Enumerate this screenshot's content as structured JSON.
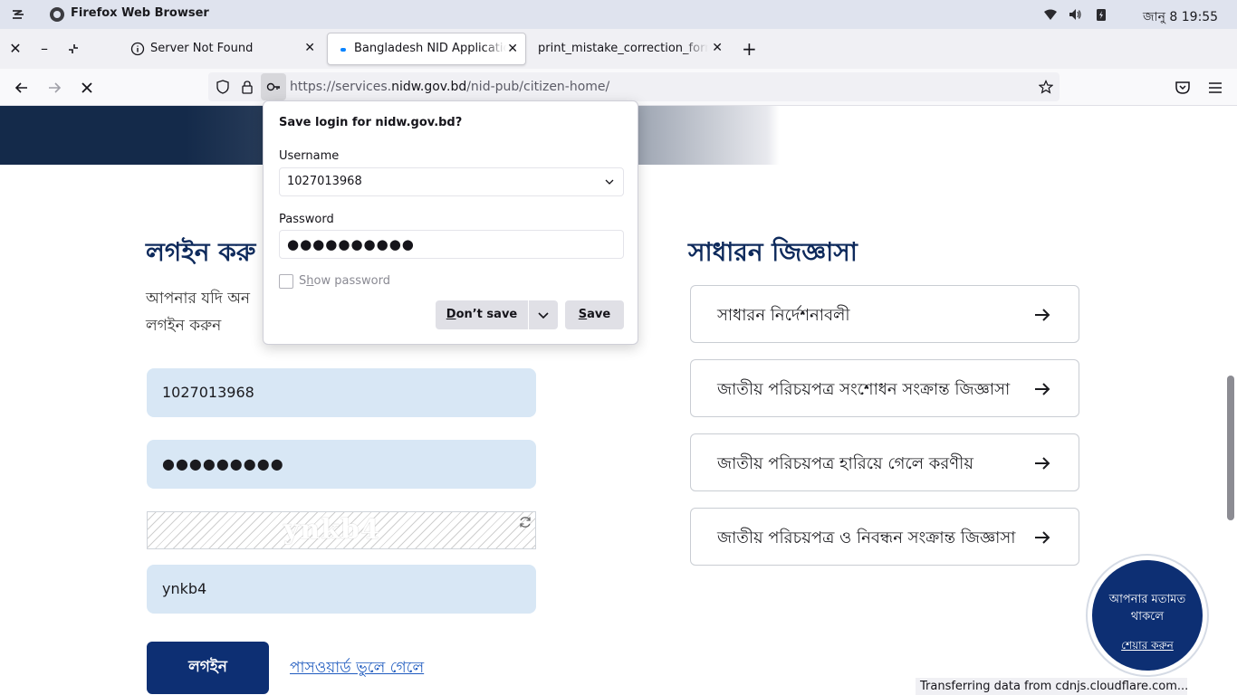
{
  "os": {
    "app_title": "Firefox Web Browser",
    "clock": "জানু 8  19:55"
  },
  "tabs": [
    {
      "label": "Server Not Found"
    },
    {
      "label": "Bangladesh NID Application"
    },
    {
      "label": "print_mistake_correction_form"
    }
  ],
  "url": {
    "prefix": "https://services.",
    "domain": "nidw.gov.bd",
    "path": "/nid-pub/citizen-home/"
  },
  "popup": {
    "title": "Save login for nidw.gov.bd?",
    "username_label": "Username",
    "username_value": "1027013968",
    "password_label": "Password",
    "password_value": "●●●●●●●●●●",
    "show_password_s": "S",
    "show_password_h": "h",
    "show_password_rest": "ow password",
    "dont_save_d": "D",
    "dont_save_rest": "on’t save",
    "save_s": "S",
    "save_rest": "ave"
  },
  "login": {
    "heading": "লগইন করু",
    "desc_line1": "আপনার যদি অন",
    "desc_line2": "লগইন করুন",
    "username_value": "1027013968",
    "password_value": "●●●●●●●●●",
    "captcha_text": "ynkb4",
    "captcha_value": "ynkb4",
    "button": "লগইন",
    "forgot_link": "পাসওয়ার্ড ভুলে গেলে"
  },
  "faq": {
    "heading": "সাধারন জিজ্ঞাসা",
    "items": [
      {
        "label": "সাধারন নির্দেশনাবলী"
      },
      {
        "label": "জাতীয় পরিচয়পত্র সংশোধন সংক্রান্ত জিজ্ঞাসা"
      },
      {
        "label": "জাতীয় পরিচয়পত্র হারিয়ে গেলে করণীয়"
      },
      {
        "label": "জাতীয় পরিচয়পত্র ও নিবন্ধন সংক্রান্ত জিজ্ঞাসা"
      }
    ]
  },
  "feedback": {
    "text": "আপনার মতামত থাকলে",
    "link": "শেয়ার করুন"
  },
  "status": "Transferring data from cdnjs.cloudflare.com...",
  "colors": {
    "brand_navy": "#0d2f73",
    "field_bg": "#d8e7f5",
    "heading": "#0e2a5c"
  }
}
